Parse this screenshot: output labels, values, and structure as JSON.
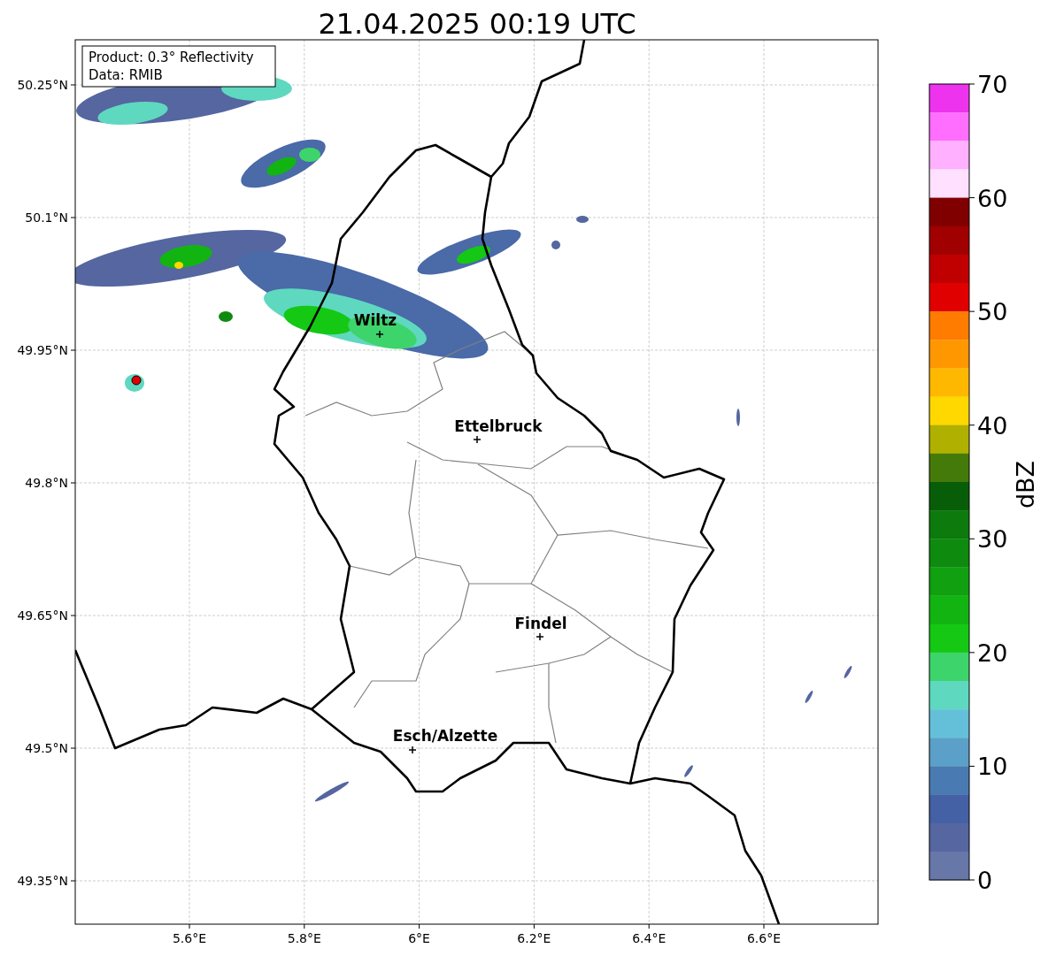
{
  "title": "21.04.2025 00:19 UTC",
  "map": {
    "info_box": [
      "Product: 0.3° Reflectivity",
      "Data: RMIB"
    ],
    "cities": [
      {
        "name": "Wiltz"
      },
      {
        "name": "Ettelbruck"
      },
      {
        "name": "Findel"
      },
      {
        "name": "Esch/Alzette"
      }
    ],
    "lat_ticks": [
      "50.25°N",
      "50.1°N",
      "49.95°N",
      "49.8°N",
      "49.65°N",
      "49.5°N",
      "49.35°N"
    ],
    "lon_ticks": [
      "5.6°E",
      "5.8°E",
      "6°E",
      "6.2°E",
      "6.4°E",
      "6.6°E"
    ]
  },
  "colorbar": {
    "label": "dBZ",
    "ticks": [
      "70",
      "60",
      "50",
      "40",
      "30",
      "20",
      "10",
      "0"
    ],
    "bins": [
      {
        "color": "#ee33ee"
      },
      {
        "color": "#ff6eff"
      },
      {
        "color": "#ffb0ff"
      },
      {
        "color": "#ffe0ff"
      },
      {
        "color": "#800000"
      },
      {
        "color": "#a00000"
      },
      {
        "color": "#c00000"
      },
      {
        "color": "#e00000"
      },
      {
        "color": "#ff7c00"
      },
      {
        "color": "#ff9800"
      },
      {
        "color": "#ffb800"
      },
      {
        "color": "#ffd800"
      },
      {
        "color": "#b0b000"
      },
      {
        "color": "#447a0a"
      },
      {
        "color": "#085e08"
      },
      {
        "color": "#0c7a0c"
      },
      {
        "color": "#0e8a0e"
      },
      {
        "color": "#10a010"
      },
      {
        "color": "#12b412"
      },
      {
        "color": "#14c814"
      },
      {
        "color": "#3ed46c"
      },
      {
        "color": "#5fd8c0"
      },
      {
        "color": "#64c0d8"
      },
      {
        "color": "#5aa0c8"
      },
      {
        "color": "#4a7ab2"
      },
      {
        "color": "#4361a4"
      },
      {
        "color": "#5566a0"
      },
      {
        "color": "#6677a8"
      }
    ]
  }
}
